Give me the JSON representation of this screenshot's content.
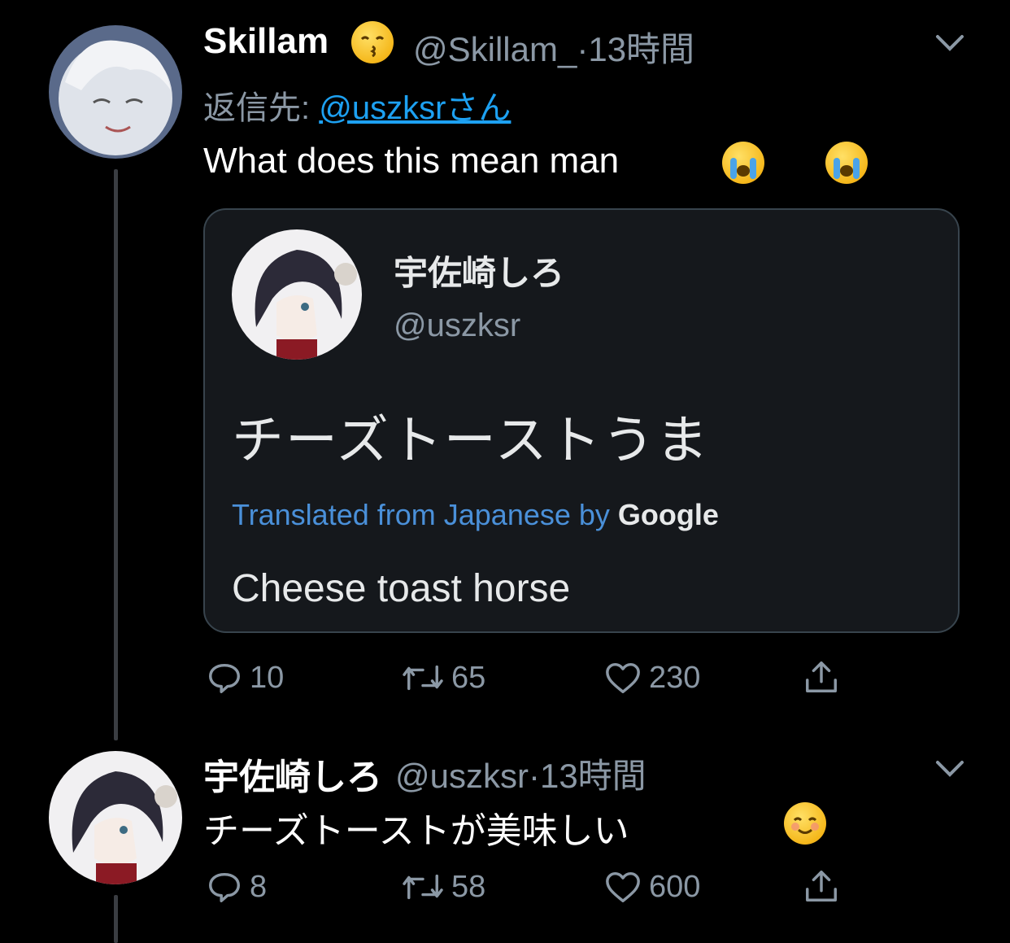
{
  "tweet1": {
    "display_name": "Skillam",
    "handle_time": "@Skillam_·13時間",
    "reply_prefix": "返信先:",
    "reply_target": "@uszksrさん",
    "text": "What does this mean man",
    "card": {
      "name": "宇佐崎しろ",
      "handle": "@uszksr",
      "original_text": "チーズトーストうま",
      "translated_label": "Translated from Japanese by",
      "translator_brand": "Google",
      "translated_text": "Cheese toast horse"
    },
    "actions": {
      "replies": "10",
      "retweets": "65",
      "likes": "230"
    }
  },
  "tweet2": {
    "display_name": "宇佐崎しろ",
    "handle_time": "@uszksr·13時間",
    "text": "チーズトーストが美味しい",
    "actions": {
      "replies": "8",
      "retweets": "58",
      "likes": "600"
    }
  },
  "colors": {
    "background": "#000000",
    "secondary_text": "#8b98a5",
    "link": "#1da1f2",
    "card_border": "#38444d",
    "thread_line": "#3a3d42"
  },
  "icons": [
    "chevron-down-icon",
    "reply-icon",
    "retweet-icon",
    "like-icon",
    "share-icon",
    "kissing-emoji",
    "crying-emoji",
    "smiling-emoji"
  ]
}
